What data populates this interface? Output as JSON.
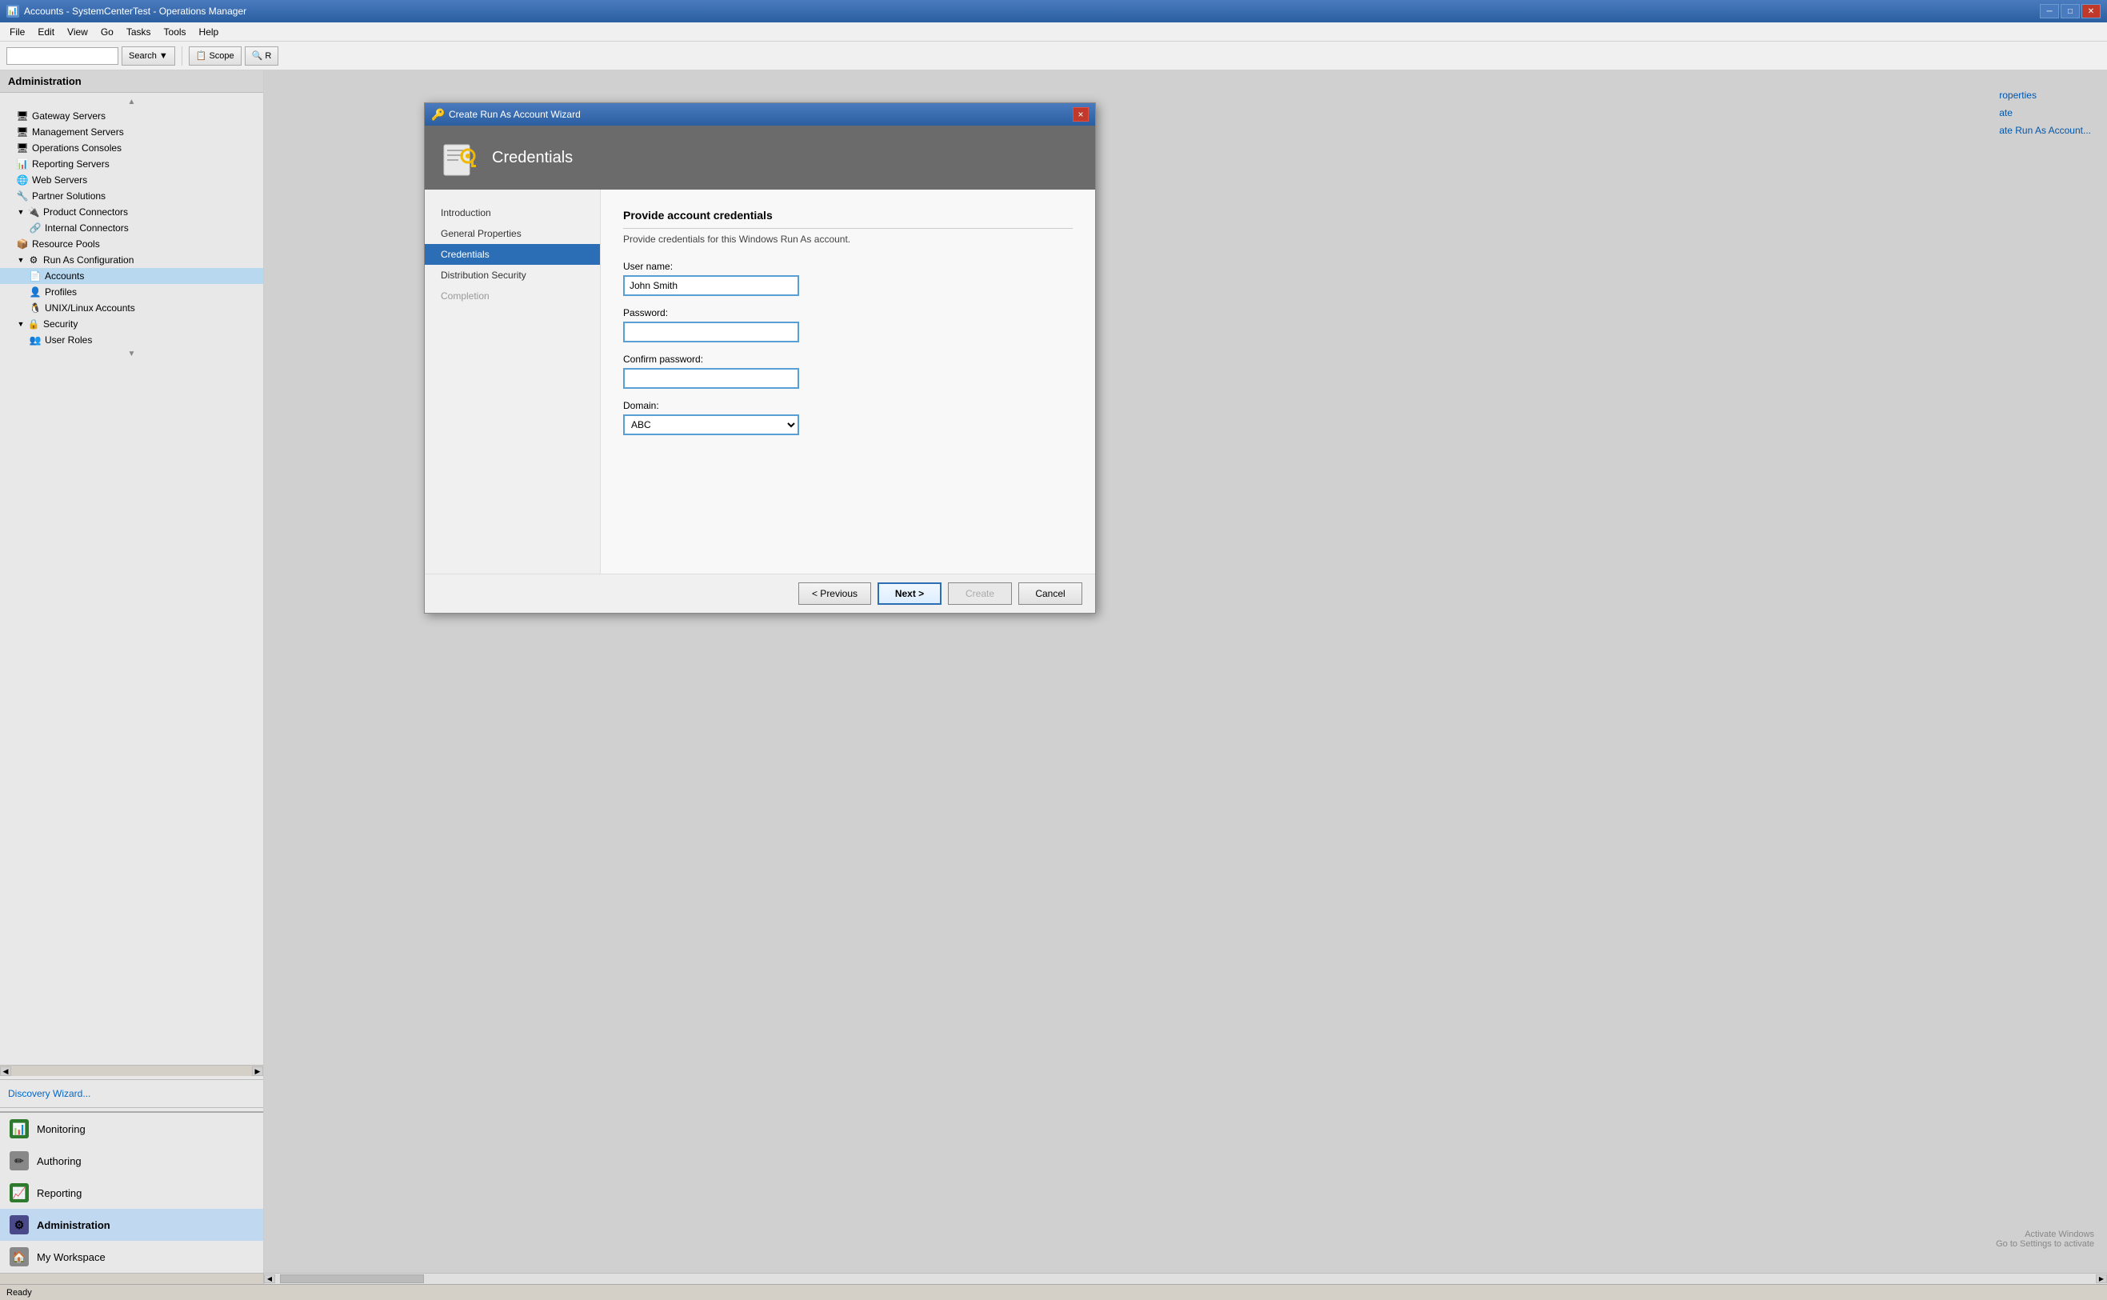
{
  "app": {
    "title": "Accounts - SystemCenterTest - Operations Manager",
    "icon": "📊"
  },
  "menubar": {
    "items": [
      "File",
      "Edit",
      "View",
      "Go",
      "Tasks",
      "Tools",
      "Help"
    ]
  },
  "toolbar": {
    "search_placeholder": "",
    "search_label": "Search",
    "scope_label": "Scope",
    "find_label": "R"
  },
  "sidebar": {
    "header": "Administration",
    "tree": [
      {
        "label": "Gateway Servers",
        "indent": 1,
        "icon": "🖥",
        "id": "gateway-servers"
      },
      {
        "label": "Management Servers",
        "indent": 1,
        "icon": "🖥",
        "id": "management-servers"
      },
      {
        "label": "Operations Consoles",
        "indent": 1,
        "icon": "🖥",
        "id": "operations-consoles"
      },
      {
        "label": "Reporting Servers",
        "indent": 1,
        "icon": "📊",
        "id": "reporting-servers"
      },
      {
        "label": "Web Servers",
        "indent": 1,
        "icon": "🌐",
        "id": "web-servers"
      },
      {
        "label": "Partner Solutions",
        "indent": 1,
        "icon": "🔧",
        "id": "partner-solutions"
      },
      {
        "label": "Product Connectors",
        "indent": 1,
        "icon": "🔌",
        "expanded": true,
        "id": "product-connectors"
      },
      {
        "label": "Internal Connectors",
        "indent": 2,
        "icon": "🔗",
        "id": "internal-connectors"
      },
      {
        "label": "Resource Pools",
        "indent": 1,
        "icon": "📦",
        "id": "resource-pools"
      },
      {
        "label": "Run As Configuration",
        "indent": 1,
        "icon": "⚙",
        "expanded": true,
        "id": "run-as-config"
      },
      {
        "label": "Accounts",
        "indent": 2,
        "icon": "📄",
        "selected": true,
        "id": "accounts"
      },
      {
        "label": "Profiles",
        "indent": 2,
        "icon": "👤",
        "id": "profiles"
      },
      {
        "label": "UNIX/Linux Accounts",
        "indent": 2,
        "icon": "🐧",
        "id": "unix-accounts"
      },
      {
        "label": "Security",
        "indent": 1,
        "icon": "🔒",
        "expanded": true,
        "id": "security"
      },
      {
        "label": "User Roles",
        "indent": 2,
        "icon": "👥",
        "id": "user-roles"
      }
    ],
    "discovery_link": "Discovery Wizard...",
    "bottom_nav": [
      {
        "label": "Monitoring",
        "icon": "📊",
        "color": "#2d7a2d",
        "id": "monitoring"
      },
      {
        "label": "Authoring",
        "icon": "✏",
        "color": "#555",
        "id": "authoring"
      },
      {
        "label": "Reporting",
        "icon": "📈",
        "color": "#2d7a2d",
        "id": "reporting"
      },
      {
        "label": "Administration",
        "icon": "⚙",
        "color": "#4a4a8a",
        "active": true,
        "id": "administration"
      },
      {
        "label": "My Workspace",
        "icon": "🏠",
        "color": "#555",
        "id": "my-workspace"
      }
    ]
  },
  "right_panel": {
    "partial_links": [
      "roperties",
      "ate",
      "ate Run As Account..."
    ]
  },
  "dialog": {
    "title": "Create Run As Account Wizard",
    "header_title": "Credentials",
    "close_btn": "×",
    "wizard_steps": [
      {
        "label": "Introduction",
        "id": "introduction",
        "active": false
      },
      {
        "label": "General Properties",
        "id": "general-properties",
        "active": false
      },
      {
        "label": "Credentials",
        "id": "credentials",
        "active": true
      },
      {
        "label": "Distribution Security",
        "id": "distribution-security",
        "active": false
      },
      {
        "label": "Completion",
        "id": "completion",
        "active": false,
        "disabled": true
      }
    ],
    "content": {
      "title": "Provide account credentials",
      "subtitle": "Provide credentials for this Windows Run As account.",
      "fields": [
        {
          "label": "User name:",
          "id": "username",
          "value": "John Smith",
          "type": "text"
        },
        {
          "label": "Password:",
          "id": "password",
          "value": "",
          "type": "password"
        },
        {
          "label": "Confirm password:",
          "id": "confirm-password",
          "value": "",
          "type": "password"
        },
        {
          "label": "Domain:",
          "id": "domain",
          "value": "ABC",
          "type": "select"
        }
      ],
      "domain_options": [
        "ABC"
      ]
    },
    "footer": {
      "previous_label": "< Previous",
      "next_label": "Next >",
      "create_label": "Create",
      "cancel_label": "Cancel"
    }
  },
  "status_bar": {
    "text": "Ready"
  },
  "activate_windows": {
    "line1": "Activate Windows",
    "line2": "Go to Settings to activate"
  }
}
